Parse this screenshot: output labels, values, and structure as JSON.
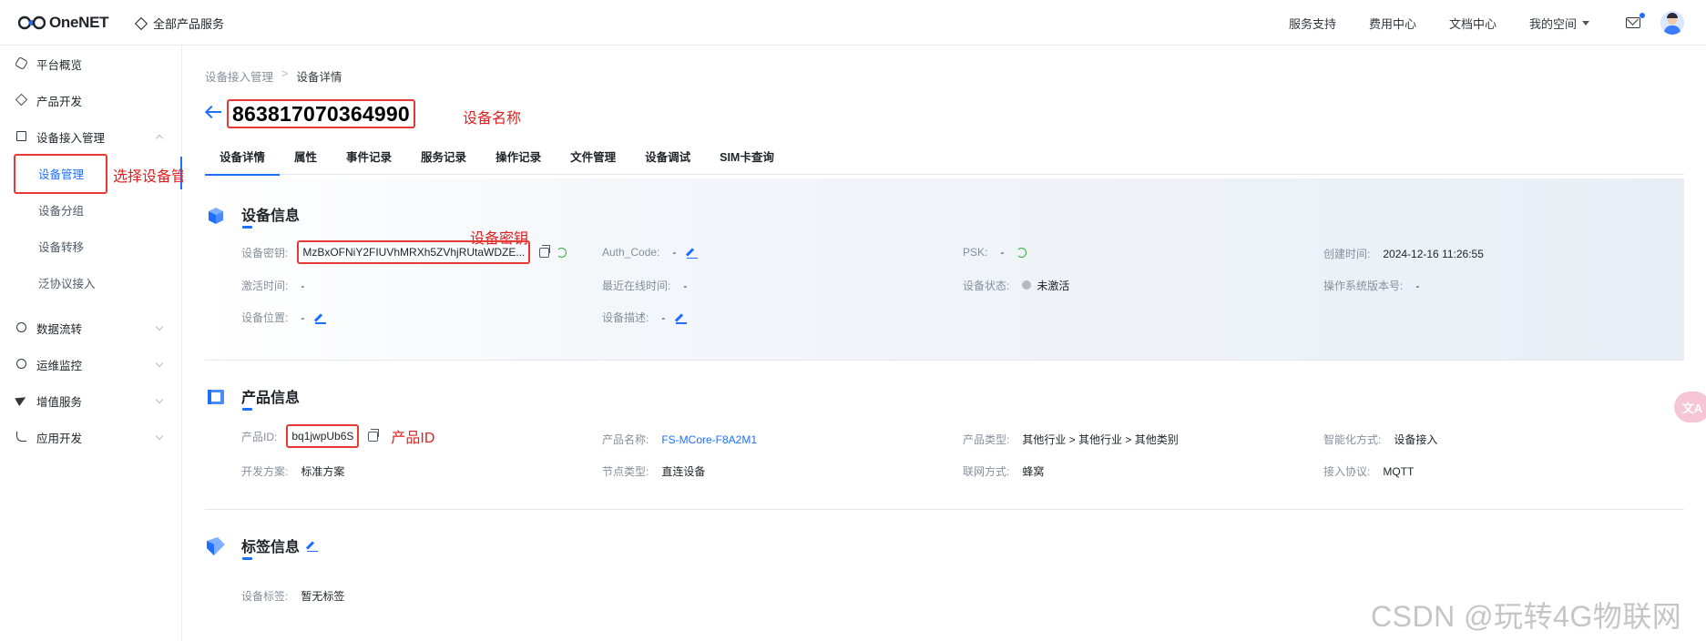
{
  "topbar": {
    "logo_text": "OneNET",
    "all_products": "全部产品服务",
    "nav": [
      "服务支持",
      "费用中心",
      "文档中心"
    ],
    "my_space": "我的空间"
  },
  "sidebar": {
    "items": [
      {
        "label": "平台概览"
      },
      {
        "label": "产品开发"
      },
      {
        "label": "设备接入管理"
      },
      {
        "label": "数据流转"
      },
      {
        "label": "运维监控"
      },
      {
        "label": "增值服务"
      },
      {
        "label": "应用开发"
      }
    ],
    "sub_items": [
      {
        "label": "设备管理"
      },
      {
        "label": "设备分组"
      },
      {
        "label": "设备转移"
      },
      {
        "label": "泛协议接入"
      }
    ]
  },
  "breadcrumb": {
    "parent": "设备接入管理",
    "separator": ">",
    "current": "设备详情"
  },
  "device_name": "863817070364990",
  "annotations": {
    "device_name": "设备名称",
    "select_manage": "选择设备管理",
    "device_key": "设备密钥",
    "product_id": "产品ID"
  },
  "tabs": [
    "设备详情",
    "属性",
    "事件记录",
    "服务记录",
    "操作记录",
    "文件管理",
    "设备调试",
    "SIM卡查询"
  ],
  "device_info": {
    "title": "设备信息",
    "key_label": "设备密钥:",
    "key_value": "MzBxOFNiY2FIUVhMRXh5ZVhjRUtaWDZE...",
    "auth_label": "Auth_Code:",
    "auth_value": "-",
    "psk_label": "PSK:",
    "psk_value": "-",
    "created_label": "创建时间:",
    "created_value": "2024-12-16 11:26:55",
    "activated_label": "激活时间:",
    "activated_value": "-",
    "last_online_label": "最近在线时间:",
    "last_online_value": "-",
    "status_label": "设备状态:",
    "status_value": "未激活",
    "os_label": "操作系统版本号:",
    "os_value": "-",
    "location_label": "设备位置:",
    "location_value": "-",
    "desc_label": "设备描述:",
    "desc_value": "-"
  },
  "product_info": {
    "title": "产品信息",
    "pid_label": "产品ID:",
    "pid_value": "bq1jwpUb6S",
    "name_label": "产品名称:",
    "name_value": "FS-MCore-F8A2M1",
    "type_label": "产品类型:",
    "type_value": "其他行业 > 其他行业 > 其他类别",
    "smart_label": "智能化方式:",
    "smart_value": "设备接入",
    "plan_label": "开发方案:",
    "plan_value": "标准方案",
    "node_label": "节点类型:",
    "node_value": "直连设备",
    "network_label": "联网方式:",
    "network_value": "蜂窝",
    "protocol_label": "接入协议:",
    "protocol_value": "MQTT"
  },
  "tag_info": {
    "title": "标签信息",
    "tags_label": "设备标签:",
    "tags_value": "暂无标签"
  },
  "watermark": "CSDN @玩转4G物联网",
  "float_button": "文A"
}
